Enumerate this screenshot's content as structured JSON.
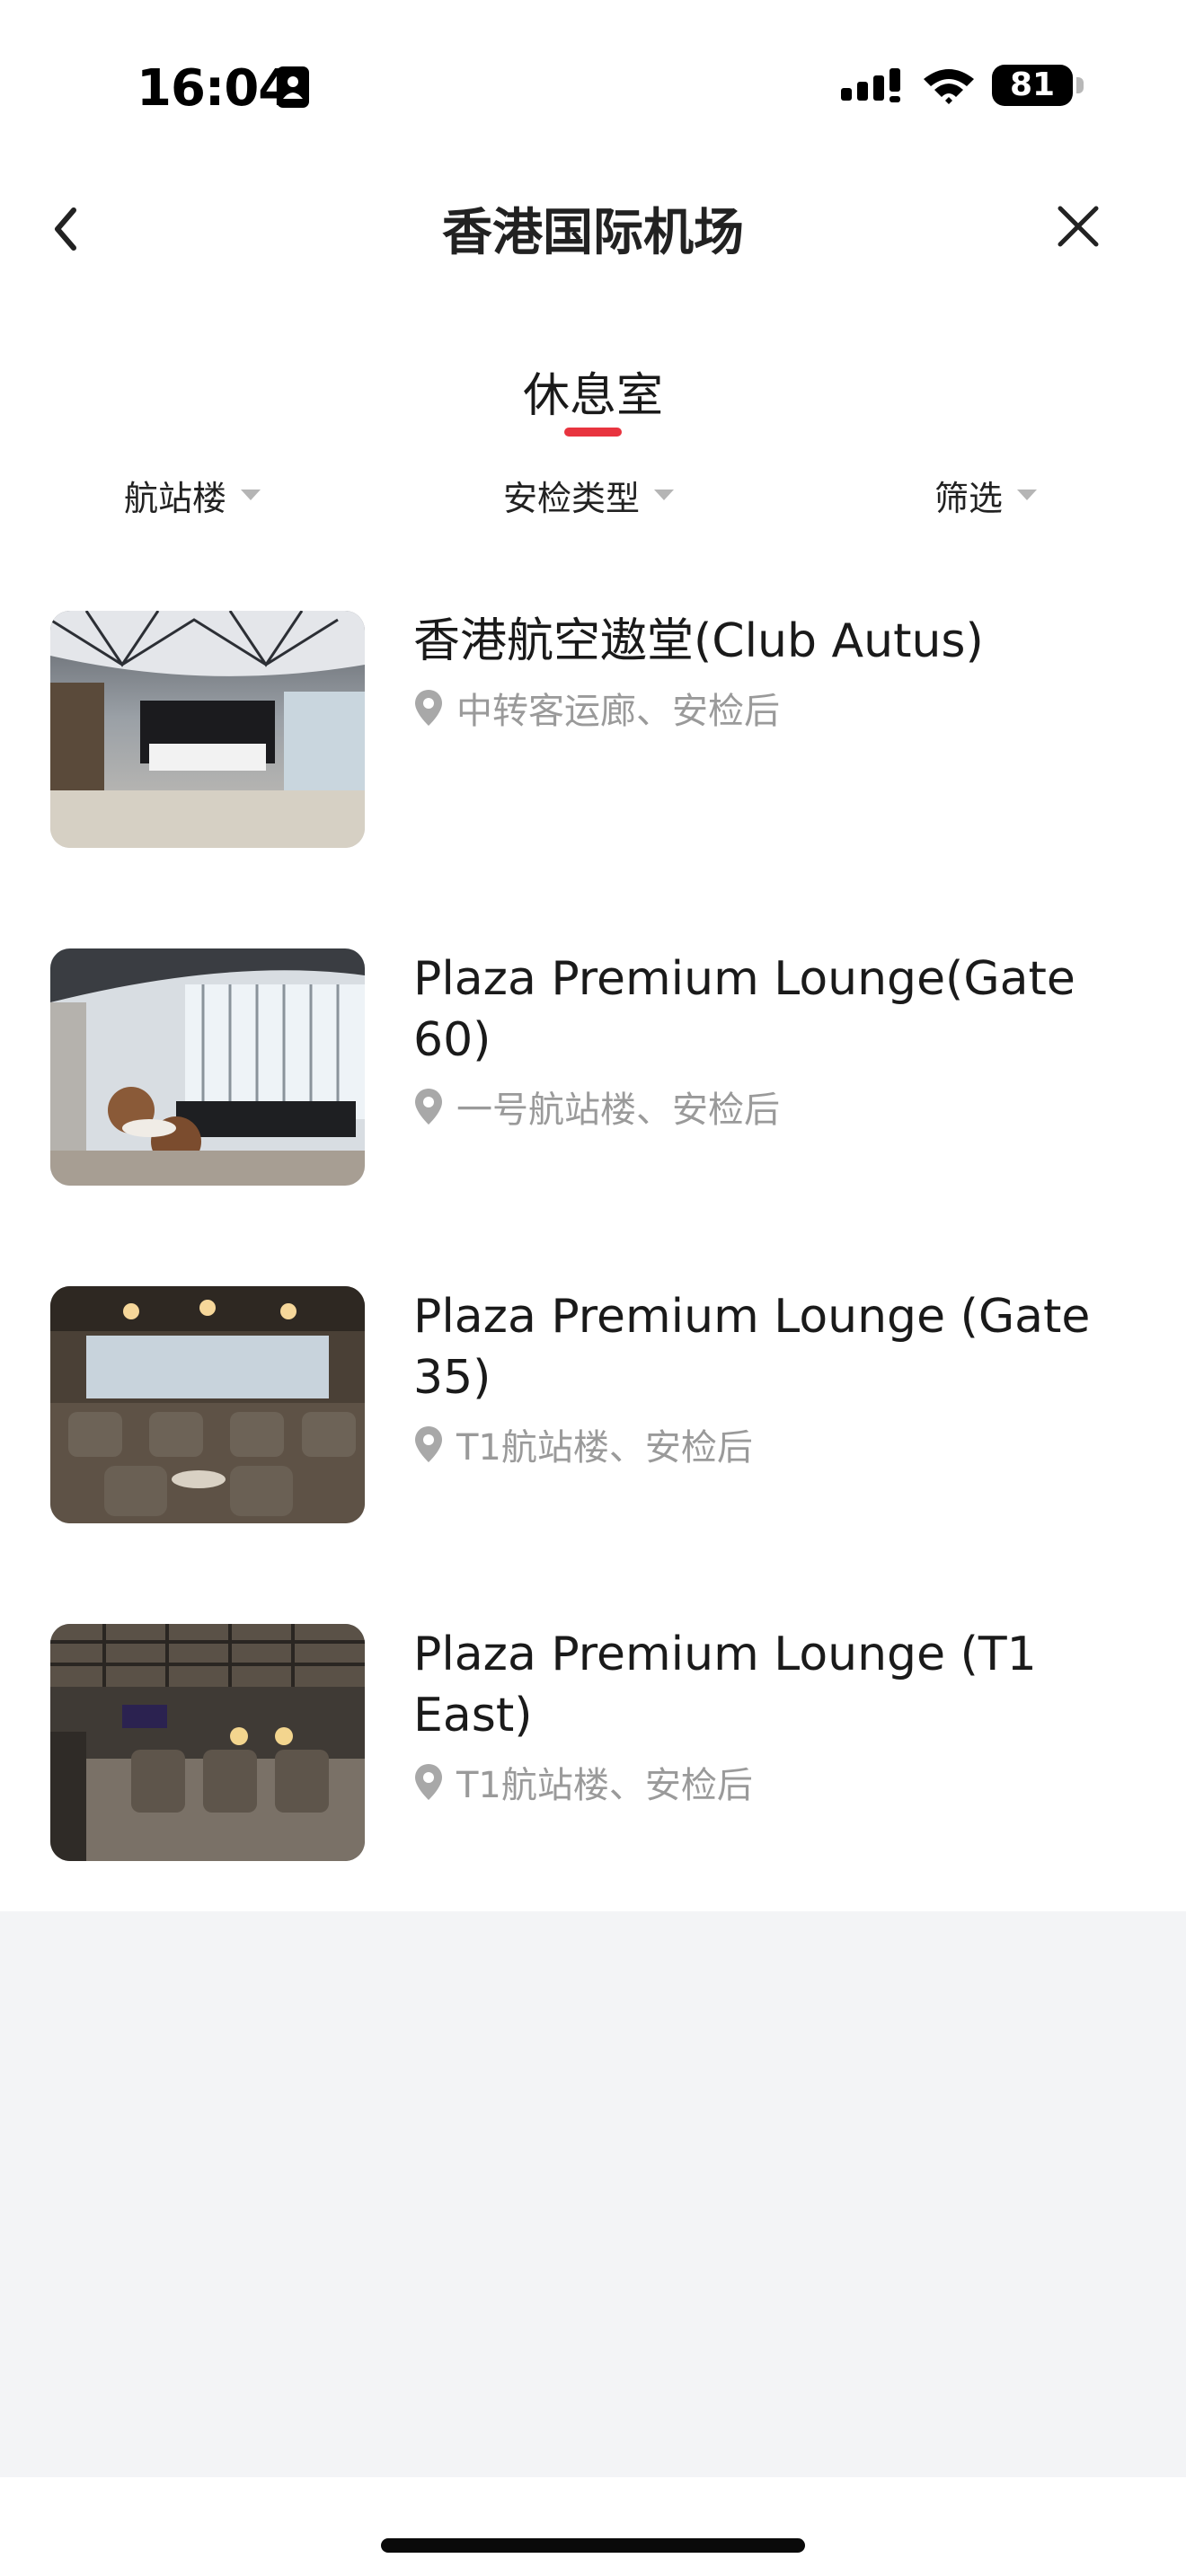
{
  "status_bar": {
    "time": "16:04",
    "battery_level": "81"
  },
  "nav": {
    "title": "香港国际机场"
  },
  "tabs": {
    "active_label": "休息室"
  },
  "filters": {
    "terminal_label": "航站楼",
    "security_type_label": "安检类型",
    "screen_label": "筛选"
  },
  "colors": {
    "accent": "#e8343f",
    "secondary_text": "#9a9a9a",
    "bottom_background": "#f3f4f6"
  },
  "lounges": [
    {
      "name": "香港航空遨堂(Club Autus)",
      "location": "中转客运廊、安检后",
      "thumb_icon": "lounge-photo"
    },
    {
      "name": "Plaza Premium Lounge(Gate 60)",
      "location": "一号航站楼、安检后",
      "thumb_icon": "lounge-photo"
    },
    {
      "name": "Plaza Premium Lounge (Gate 35)",
      "location": "T1航站楼、安检后",
      "thumb_icon": "lounge-photo"
    },
    {
      "name": "Plaza Premium Lounge (T1 East)",
      "location": "T1航站楼、安检后",
      "thumb_icon": "lounge-photo"
    }
  ]
}
